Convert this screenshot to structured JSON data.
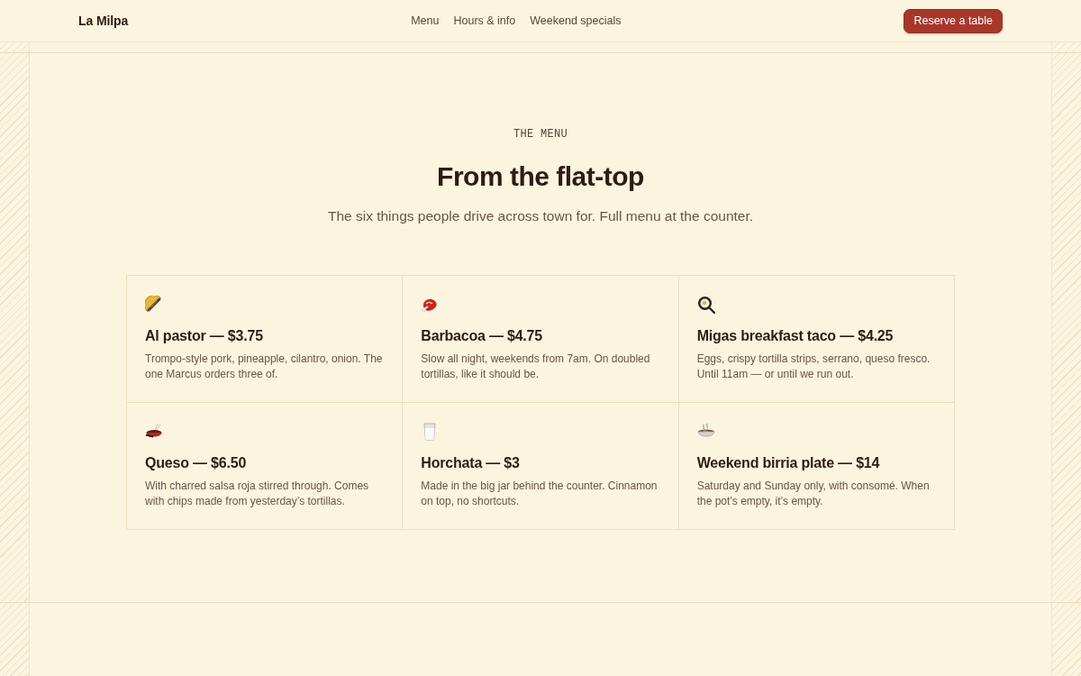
{
  "brand": "La Milpa",
  "nav": {
    "links": [
      {
        "label": "Menu"
      },
      {
        "label": "Hours & info"
      },
      {
        "label": "Weekend specials"
      }
    ],
    "button": "Reserve a table"
  },
  "section": {
    "eyebrow": "THE MENU",
    "title": "From the flat-top",
    "subtitle": "The six things people drive across town for. Full menu at the counter."
  },
  "items": [
    {
      "title": "Al pastor — $3.75",
      "description": "Trompo-style pork, pineapple, cilantro, onion. The one Marcus orders three of."
    },
    {
      "title": "Barbacoa — $4.75",
      "description": "Slow all night, weekends from 7am. On doubled tortillas, like it should be."
    },
    {
      "title": "Migas breakfast taco — $4.25",
      "description": "Eggs, crispy tortilla strips, serrano, queso fresco. Until 11am — or until we run out."
    },
    {
      "title": "Queso — $6.50",
      "description": "With charred salsa roja stirred through. Comes with chips made from yesterday’s tortillas."
    },
    {
      "title": "Horchata — $3",
      "description": "Made in the big jar behind the counter. Cinnamon on top, no shortcuts."
    },
    {
      "title": "Weekend birria plate — $14",
      "description": "Saturday and Sunday only, with consomé. When the pot’s empty, it’s empty."
    }
  ]
}
